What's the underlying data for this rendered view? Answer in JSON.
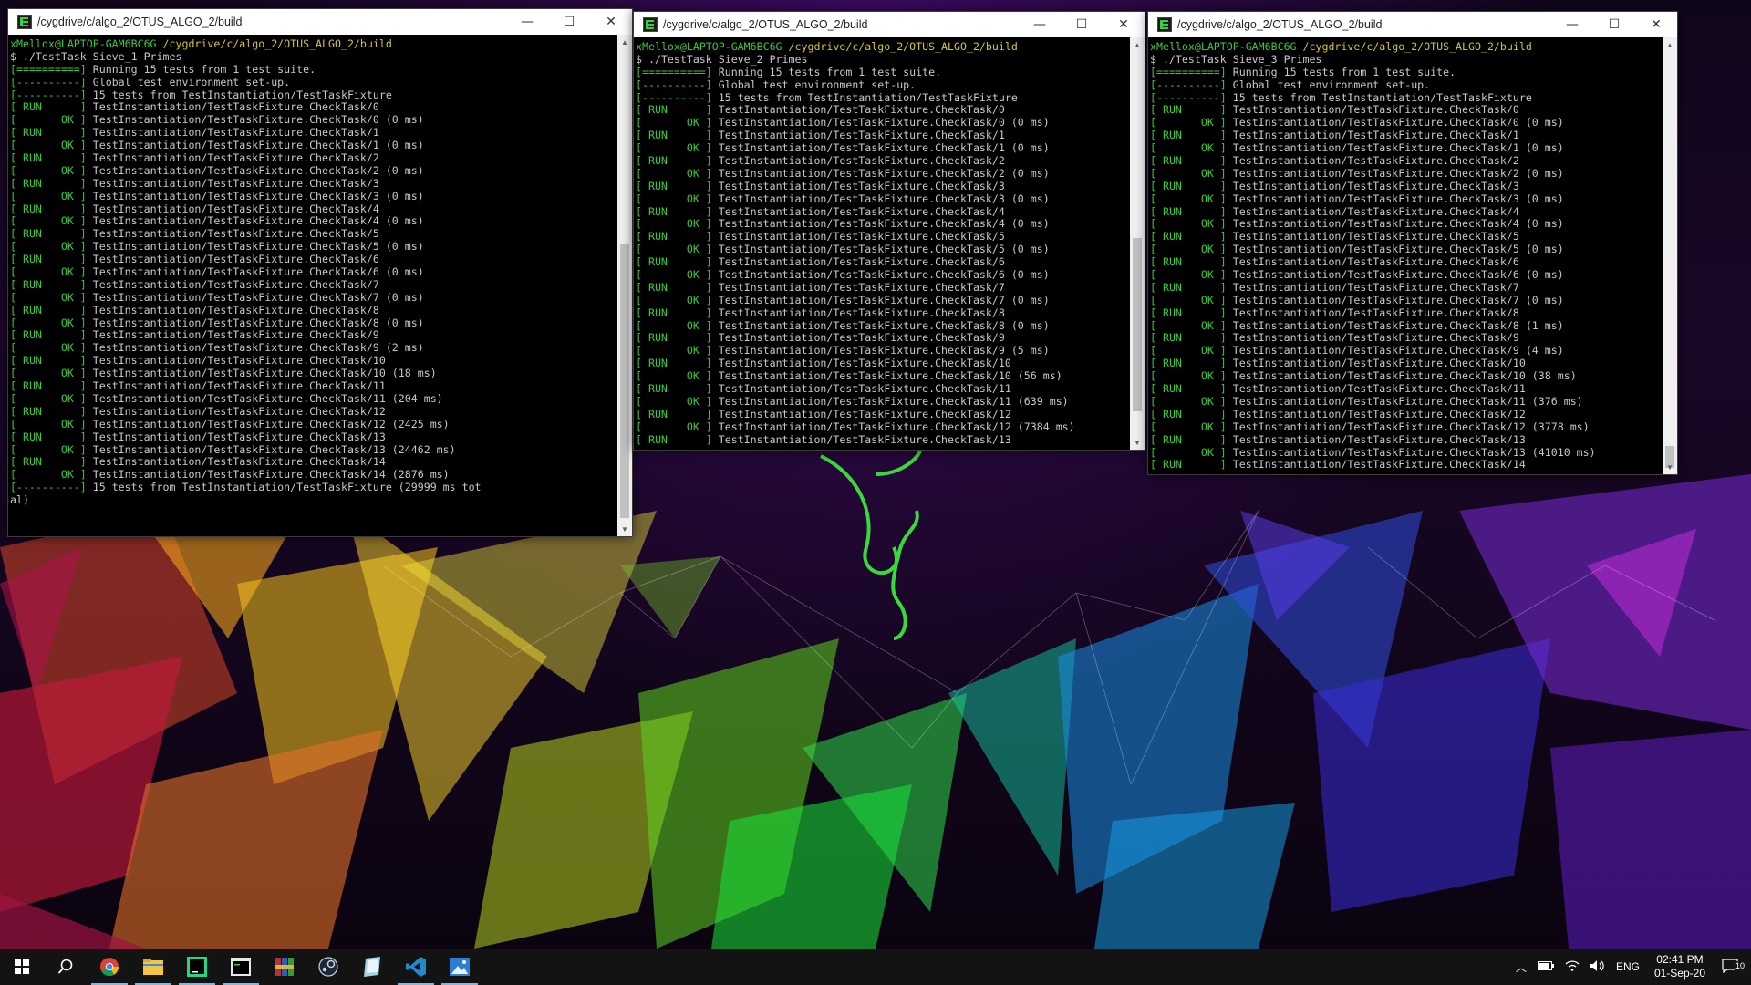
{
  "windows": [
    {
      "title": "/cygdrive/c/algo_2/OTUS_ALGO_2/build",
      "lines": [
        {
          "t": "prompt",
          "user": "xMellox@LAPTOP-GAM6BC6G",
          "path": "/cygdrive/c/algo_2/OTUS_ALGO_2/build"
        },
        {
          "t": "text",
          "text": "$ ./TestTask Sieve_1 Primes"
        },
        {
          "t": "tag",
          "tag": "[==========]",
          "text": "Running 15 tests from 1 test suite."
        },
        {
          "t": "tag",
          "tag": "[----------]",
          "text": "Global test environment set-up."
        },
        {
          "t": "tag",
          "tag": "[----------]",
          "text": "15 tests from TestInstantiation/TestTaskFixture"
        },
        {
          "t": "tag",
          "tag": "[ RUN      ]",
          "text": "TestInstantiation/TestTaskFixture.CheckTask/0"
        },
        {
          "t": "tag",
          "tag": "[       OK ]",
          "text": "TestInstantiation/TestTaskFixture.CheckTask/0 (0 ms)"
        },
        {
          "t": "tag",
          "tag": "[ RUN      ]",
          "text": "TestInstantiation/TestTaskFixture.CheckTask/1"
        },
        {
          "t": "tag",
          "tag": "[       OK ]",
          "text": "TestInstantiation/TestTaskFixture.CheckTask/1 (0 ms)"
        },
        {
          "t": "tag",
          "tag": "[ RUN      ]",
          "text": "TestInstantiation/TestTaskFixture.CheckTask/2"
        },
        {
          "t": "tag",
          "tag": "[       OK ]",
          "text": "TestInstantiation/TestTaskFixture.CheckTask/2 (0 ms)"
        },
        {
          "t": "tag",
          "tag": "[ RUN      ]",
          "text": "TestInstantiation/TestTaskFixture.CheckTask/3"
        },
        {
          "t": "tag",
          "tag": "[       OK ]",
          "text": "TestInstantiation/TestTaskFixture.CheckTask/3 (0 ms)"
        },
        {
          "t": "tag",
          "tag": "[ RUN      ]",
          "text": "TestInstantiation/TestTaskFixture.CheckTask/4"
        },
        {
          "t": "tag",
          "tag": "[       OK ]",
          "text": "TestInstantiation/TestTaskFixture.CheckTask/4 (0 ms)"
        },
        {
          "t": "tag",
          "tag": "[ RUN      ]",
          "text": "TestInstantiation/TestTaskFixture.CheckTask/5"
        },
        {
          "t": "tag",
          "tag": "[       OK ]",
          "text": "TestInstantiation/TestTaskFixture.CheckTask/5 (0 ms)"
        },
        {
          "t": "tag",
          "tag": "[ RUN      ]",
          "text": "TestInstantiation/TestTaskFixture.CheckTask/6"
        },
        {
          "t": "tag",
          "tag": "[       OK ]",
          "text": "TestInstantiation/TestTaskFixture.CheckTask/6 (0 ms)"
        },
        {
          "t": "tag",
          "tag": "[ RUN      ]",
          "text": "TestInstantiation/TestTaskFixture.CheckTask/7"
        },
        {
          "t": "tag",
          "tag": "[       OK ]",
          "text": "TestInstantiation/TestTaskFixture.CheckTask/7 (0 ms)"
        },
        {
          "t": "tag",
          "tag": "[ RUN      ]",
          "text": "TestInstantiation/TestTaskFixture.CheckTask/8"
        },
        {
          "t": "tag",
          "tag": "[       OK ]",
          "text": "TestInstantiation/TestTaskFixture.CheckTask/8 (0 ms)"
        },
        {
          "t": "tag",
          "tag": "[ RUN      ]",
          "text": "TestInstantiation/TestTaskFixture.CheckTask/9"
        },
        {
          "t": "tag",
          "tag": "[       OK ]",
          "text": "TestInstantiation/TestTaskFixture.CheckTask/9 (2 ms)"
        },
        {
          "t": "tag",
          "tag": "[ RUN      ]",
          "text": "TestInstantiation/TestTaskFixture.CheckTask/10"
        },
        {
          "t": "tag",
          "tag": "[       OK ]",
          "text": "TestInstantiation/TestTaskFixture.CheckTask/10 (18 ms)"
        },
        {
          "t": "tag",
          "tag": "[ RUN      ]",
          "text": "TestInstantiation/TestTaskFixture.CheckTask/11"
        },
        {
          "t": "tag",
          "tag": "[       OK ]",
          "text": "TestInstantiation/TestTaskFixture.CheckTask/11 (204 ms)"
        },
        {
          "t": "tag",
          "tag": "[ RUN      ]",
          "text": "TestInstantiation/TestTaskFixture.CheckTask/12"
        },
        {
          "t": "tag",
          "tag": "[       OK ]",
          "text": "TestInstantiation/TestTaskFixture.CheckTask/12 (2425 ms)"
        },
        {
          "t": "tag",
          "tag": "[ RUN      ]",
          "text": "TestInstantiation/TestTaskFixture.CheckTask/13"
        },
        {
          "t": "tag",
          "tag": "[       OK ]",
          "text": "TestInstantiation/TestTaskFixture.CheckTask/13 (24462 ms)"
        },
        {
          "t": "tag",
          "tag": "[ RUN      ]",
          "text": "TestInstantiation/TestTaskFixture.CheckTask/14"
        },
        {
          "t": "tag",
          "tag": "[       OK ]",
          "text": "TestInstantiation/TestTaskFixture.CheckTask/14 (2876 ms)"
        },
        {
          "t": "tag",
          "tag": "[----------]",
          "text": "15 tests from TestInstantiation/TestTaskFixture (29999 ms tot"
        },
        {
          "t": "text",
          "text": "al)"
        }
      ]
    },
    {
      "title": "/cygdrive/c/algo_2/OTUS_ALGO_2/build",
      "lines": [
        {
          "t": "prompt",
          "user": "xMellox@LAPTOP-GAM6BC6G",
          "path": "/cygdrive/c/algo_2/OTUS_ALGO_2/build"
        },
        {
          "t": "text",
          "text": "$ ./TestTask Sieve_2 Primes"
        },
        {
          "t": "tag",
          "tag": "[==========]",
          "text": "Running 15 tests from 1 test suite."
        },
        {
          "t": "tag",
          "tag": "[----------]",
          "text": "Global test environment set-up."
        },
        {
          "t": "tag",
          "tag": "[----------]",
          "text": "15 tests from TestInstantiation/TestTaskFixture"
        },
        {
          "t": "tag",
          "tag": "[ RUN      ]",
          "text": "TestInstantiation/TestTaskFixture.CheckTask/0"
        },
        {
          "t": "tag",
          "tag": "[       OK ]",
          "text": "TestInstantiation/TestTaskFixture.CheckTask/0 (0 ms)"
        },
        {
          "t": "tag",
          "tag": "[ RUN      ]",
          "text": "TestInstantiation/TestTaskFixture.CheckTask/1"
        },
        {
          "t": "tag",
          "tag": "[       OK ]",
          "text": "TestInstantiation/TestTaskFixture.CheckTask/1 (0 ms)"
        },
        {
          "t": "tag",
          "tag": "[ RUN      ]",
          "text": "TestInstantiation/TestTaskFixture.CheckTask/2"
        },
        {
          "t": "tag",
          "tag": "[       OK ]",
          "text": "TestInstantiation/TestTaskFixture.CheckTask/2 (0 ms)"
        },
        {
          "t": "tag",
          "tag": "[ RUN      ]",
          "text": "TestInstantiation/TestTaskFixture.CheckTask/3"
        },
        {
          "t": "tag",
          "tag": "[       OK ]",
          "text": "TestInstantiation/TestTaskFixture.CheckTask/3 (0 ms)"
        },
        {
          "t": "tag",
          "tag": "[ RUN      ]",
          "text": "TestInstantiation/TestTaskFixture.CheckTask/4"
        },
        {
          "t": "tag",
          "tag": "[       OK ]",
          "text": "TestInstantiation/TestTaskFixture.CheckTask/4 (0 ms)"
        },
        {
          "t": "tag",
          "tag": "[ RUN      ]",
          "text": "TestInstantiation/TestTaskFixture.CheckTask/5"
        },
        {
          "t": "tag",
          "tag": "[       OK ]",
          "text": "TestInstantiation/TestTaskFixture.CheckTask/5 (0 ms)"
        },
        {
          "t": "tag",
          "tag": "[ RUN      ]",
          "text": "TestInstantiation/TestTaskFixture.CheckTask/6"
        },
        {
          "t": "tag",
          "tag": "[       OK ]",
          "text": "TestInstantiation/TestTaskFixture.CheckTask/6 (0 ms)"
        },
        {
          "t": "tag",
          "tag": "[ RUN      ]",
          "text": "TestInstantiation/TestTaskFixture.CheckTask/7"
        },
        {
          "t": "tag",
          "tag": "[       OK ]",
          "text": "TestInstantiation/TestTaskFixture.CheckTask/7 (0 ms)"
        },
        {
          "t": "tag",
          "tag": "[ RUN      ]",
          "text": "TestInstantiation/TestTaskFixture.CheckTask/8"
        },
        {
          "t": "tag",
          "tag": "[       OK ]",
          "text": "TestInstantiation/TestTaskFixture.CheckTask/8 (0 ms)"
        },
        {
          "t": "tag",
          "tag": "[ RUN      ]",
          "text": "TestInstantiation/TestTaskFixture.CheckTask/9"
        },
        {
          "t": "tag",
          "tag": "[       OK ]",
          "text": "TestInstantiation/TestTaskFixture.CheckTask/9 (5 ms)"
        },
        {
          "t": "tag",
          "tag": "[ RUN      ]",
          "text": "TestInstantiation/TestTaskFixture.CheckTask/10"
        },
        {
          "t": "tag",
          "tag": "[       OK ]",
          "text": "TestInstantiation/TestTaskFixture.CheckTask/10 (56 ms)"
        },
        {
          "t": "tag",
          "tag": "[ RUN      ]",
          "text": "TestInstantiation/TestTaskFixture.CheckTask/11"
        },
        {
          "t": "tag",
          "tag": "[       OK ]",
          "text": "TestInstantiation/TestTaskFixture.CheckTask/11 (639 ms)"
        },
        {
          "t": "tag",
          "tag": "[ RUN      ]",
          "text": "TestInstantiation/TestTaskFixture.CheckTask/12"
        },
        {
          "t": "tag",
          "tag": "[       OK ]",
          "text": "TestInstantiation/TestTaskFixture.CheckTask/12 (7384 ms)"
        },
        {
          "t": "tag",
          "tag": "[ RUN      ]",
          "text": "TestInstantiation/TestTaskFixture.CheckTask/13"
        }
      ]
    },
    {
      "title": "/cygdrive/c/algo_2/OTUS_ALGO_2/build",
      "lines": [
        {
          "t": "prompt",
          "user": "xMellox@LAPTOP-GAM6BC6G",
          "path": "/cygdrive/c/algo_2/OTUS_ALGO_2/build"
        },
        {
          "t": "text",
          "text": "$ ./TestTask Sieve_3 Primes"
        },
        {
          "t": "tag",
          "tag": "[==========]",
          "text": "Running 15 tests from 1 test suite."
        },
        {
          "t": "tag",
          "tag": "[----------]",
          "text": "Global test environment set-up."
        },
        {
          "t": "tag",
          "tag": "[----------]",
          "text": "15 tests from TestInstantiation/TestTaskFixture"
        },
        {
          "t": "tag",
          "tag": "[ RUN      ]",
          "text": "TestInstantiation/TestTaskFixture.CheckTask/0"
        },
        {
          "t": "tag",
          "tag": "[       OK ]",
          "text": "TestInstantiation/TestTaskFixture.CheckTask/0 (0 ms)"
        },
        {
          "t": "tag",
          "tag": "[ RUN      ]",
          "text": "TestInstantiation/TestTaskFixture.CheckTask/1"
        },
        {
          "t": "tag",
          "tag": "[       OK ]",
          "text": "TestInstantiation/TestTaskFixture.CheckTask/1 (0 ms)"
        },
        {
          "t": "tag",
          "tag": "[ RUN      ]",
          "text": "TestInstantiation/TestTaskFixture.CheckTask/2"
        },
        {
          "t": "tag",
          "tag": "[       OK ]",
          "text": "TestInstantiation/TestTaskFixture.CheckTask/2 (0 ms)"
        },
        {
          "t": "tag",
          "tag": "[ RUN      ]",
          "text": "TestInstantiation/TestTaskFixture.CheckTask/3"
        },
        {
          "t": "tag",
          "tag": "[       OK ]",
          "text": "TestInstantiation/TestTaskFixture.CheckTask/3 (0 ms)"
        },
        {
          "t": "tag",
          "tag": "[ RUN      ]",
          "text": "TestInstantiation/TestTaskFixture.CheckTask/4"
        },
        {
          "t": "tag",
          "tag": "[       OK ]",
          "text": "TestInstantiation/TestTaskFixture.CheckTask/4 (0 ms)"
        },
        {
          "t": "tag",
          "tag": "[ RUN      ]",
          "text": "TestInstantiation/TestTaskFixture.CheckTask/5"
        },
        {
          "t": "tag",
          "tag": "[       OK ]",
          "text": "TestInstantiation/TestTaskFixture.CheckTask/5 (0 ms)"
        },
        {
          "t": "tag",
          "tag": "[ RUN      ]",
          "text": "TestInstantiation/TestTaskFixture.CheckTask/6"
        },
        {
          "t": "tag",
          "tag": "[       OK ]",
          "text": "TestInstantiation/TestTaskFixture.CheckTask/6 (0 ms)"
        },
        {
          "t": "tag",
          "tag": "[ RUN      ]",
          "text": "TestInstantiation/TestTaskFixture.CheckTask/7"
        },
        {
          "t": "tag",
          "tag": "[       OK ]",
          "text": "TestInstantiation/TestTaskFixture.CheckTask/7 (0 ms)"
        },
        {
          "t": "tag",
          "tag": "[ RUN      ]",
          "text": "TestInstantiation/TestTaskFixture.CheckTask/8"
        },
        {
          "t": "tag",
          "tag": "[       OK ]",
          "text": "TestInstantiation/TestTaskFixture.CheckTask/8 (1 ms)"
        },
        {
          "t": "tag",
          "tag": "[ RUN      ]",
          "text": "TestInstantiation/TestTaskFixture.CheckTask/9"
        },
        {
          "t": "tag",
          "tag": "[       OK ]",
          "text": "TestInstantiation/TestTaskFixture.CheckTask/9 (4 ms)"
        },
        {
          "t": "tag",
          "tag": "[ RUN      ]",
          "text": "TestInstantiation/TestTaskFixture.CheckTask/10"
        },
        {
          "t": "tag",
          "tag": "[       OK ]",
          "text": "TestInstantiation/TestTaskFixture.CheckTask/10 (38 ms)"
        },
        {
          "t": "tag",
          "tag": "[ RUN      ]",
          "text": "TestInstantiation/TestTaskFixture.CheckTask/11"
        },
        {
          "t": "tag",
          "tag": "[       OK ]",
          "text": "TestInstantiation/TestTaskFixture.CheckTask/11 (376 ms)"
        },
        {
          "t": "tag",
          "tag": "[ RUN      ]",
          "text": "TestInstantiation/TestTaskFixture.CheckTask/12"
        },
        {
          "t": "tag",
          "tag": "[       OK ]",
          "text": "TestInstantiation/TestTaskFixture.CheckTask/12 (3778 ms)"
        },
        {
          "t": "tag",
          "tag": "[ RUN      ]",
          "text": "TestInstantiation/TestTaskFixture.CheckTask/13"
        },
        {
          "t": "tag",
          "tag": "[       OK ]",
          "text": "TestInstantiation/TestTaskFixture.CheckTask/13 (41010 ms)"
        },
        {
          "t": "tag",
          "tag": "[ RUN      ]",
          "text": "TestInstantiation/TestTaskFixture.CheckTask/14"
        }
      ]
    }
  ],
  "window_controls": {
    "minimize": "—",
    "maximize": "☐",
    "close": "✕"
  },
  "taskbar": {
    "apps": [
      {
        "name": "start-button",
        "icon": "windows-logo-icon"
      },
      {
        "name": "search-button",
        "icon": "search-icon"
      },
      {
        "name": "chrome-button",
        "icon": "chrome-icon"
      },
      {
        "name": "file-explorer-button",
        "icon": "folder-icon"
      },
      {
        "name": "clion-button",
        "icon": "clion-icon"
      },
      {
        "name": "cygwin-terminal-button",
        "icon": "terminal-icon"
      },
      {
        "name": "winrar-button",
        "icon": "archive-icon"
      },
      {
        "name": "steam-button",
        "icon": "steam-icon"
      },
      {
        "name": "notes-button",
        "icon": "notes-icon"
      },
      {
        "name": "vscode-button",
        "icon": "vscode-icon"
      },
      {
        "name": "image-viewer-button",
        "icon": "image-icon"
      }
    ],
    "tray": {
      "language": "ENG",
      "time": "02:41 PM",
      "date": "01-Sep-20",
      "notifications_count": "10"
    }
  },
  "colors": {
    "terminal_green": "#3cc83c",
    "terminal_yellow": "#d2c43a",
    "terminal_text": "#c8c8c8",
    "taskbar_accent": "#76b9ed"
  }
}
